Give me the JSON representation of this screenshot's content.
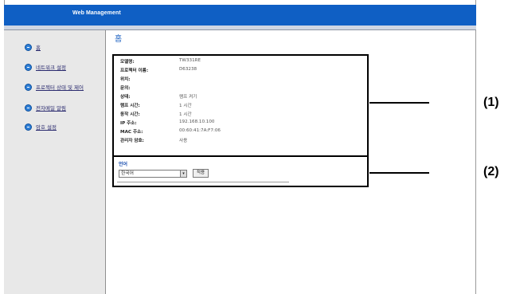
{
  "header": {
    "title": "Web Management"
  },
  "sidebar": {
    "items": [
      {
        "label": "홈"
      },
      {
        "label": "네트워크 설정"
      },
      {
        "label": "프로젝터 상태 및 제어"
      },
      {
        "label": "전자메일 알림"
      },
      {
        "label": "암호 설정"
      }
    ]
  },
  "main": {
    "page_title": "홈",
    "info": [
      {
        "label": "모델명:",
        "value": "TW331RE"
      },
      {
        "label": "프로젝터 이름:",
        "value": "D63238"
      },
      {
        "label": "위치:",
        "value": ""
      },
      {
        "label": "문의:",
        "value": ""
      },
      {
        "label": "상태:",
        "value": "램프 켜기"
      },
      {
        "label": "램프 시간:",
        "value": "1 시간"
      },
      {
        "label": "동작 시간:",
        "value": "1 시간"
      },
      {
        "label": "IP 주소:",
        "value": "192.168.10.100"
      },
      {
        "label": "MAC 주소:",
        "value": "00:60:41:7A:F7:06"
      },
      {
        "label": "관리자 암호:",
        "value": "사용"
      }
    ],
    "language": {
      "label": "언어",
      "selected": "한국어",
      "apply_label": "적용"
    }
  },
  "callouts": {
    "one": "(1)",
    "two": "(2)"
  }
}
